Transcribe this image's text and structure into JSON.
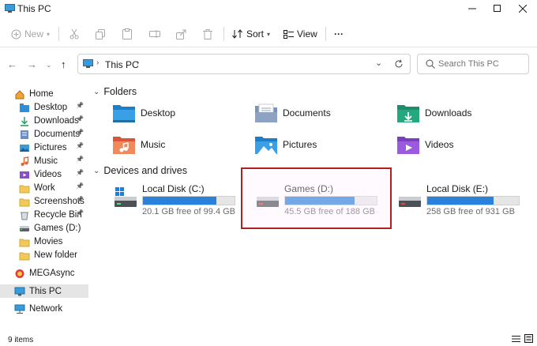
{
  "window": {
    "title": "This PC"
  },
  "toolbar": {
    "new_label": "New",
    "sort_label": "Sort",
    "view_label": "View",
    "more_label": "···"
  },
  "address": {
    "location": "This PC",
    "search_placeholder": "Search This PC"
  },
  "sidebar": {
    "items": [
      {
        "label": "Home",
        "icon": "home-icon"
      },
      {
        "label": "Desktop",
        "icon": "desktop-folder-icon",
        "pinned": true
      },
      {
        "label": "Downloads",
        "icon": "download-icon",
        "pinned": true
      },
      {
        "label": "Documents",
        "icon": "documents-icon",
        "pinned": true
      },
      {
        "label": "Pictures",
        "icon": "pictures-icon",
        "pinned": true
      },
      {
        "label": "Music",
        "icon": "music-icon",
        "pinned": true
      },
      {
        "label": "Videos",
        "icon": "videos-icon",
        "pinned": true
      },
      {
        "label": "Work",
        "icon": "folder-icon",
        "pinned": true
      },
      {
        "label": "Screenshots",
        "icon": "folder-icon",
        "pinned": true
      },
      {
        "label": "Recycle Bin",
        "icon": "recycle-bin-icon",
        "pinned": true
      },
      {
        "label": "Games (D:)",
        "icon": "drive-icon"
      },
      {
        "label": "Movies",
        "icon": "folder-icon"
      },
      {
        "label": "New folder",
        "icon": "folder-icon"
      },
      {
        "label": "MEGAsync",
        "icon": "megasync-icon"
      },
      {
        "label": "This PC",
        "icon": "this-pc-icon",
        "selected": true
      },
      {
        "label": "Network",
        "icon": "network-icon"
      }
    ]
  },
  "folders": {
    "heading": "Folders",
    "items": [
      {
        "label": "Desktop",
        "icon": "desktop-folder-icon"
      },
      {
        "label": "Documents",
        "icon": "documents-folder-icon"
      },
      {
        "label": "Downloads",
        "icon": "downloads-folder-icon"
      },
      {
        "label": "Music",
        "icon": "music-folder-icon"
      },
      {
        "label": "Pictures",
        "icon": "pictures-folder-icon"
      },
      {
        "label": "Videos",
        "icon": "videos-folder-icon"
      }
    ]
  },
  "drives": {
    "heading": "Devices and drives",
    "items": [
      {
        "name": "Local Disk (C:)",
        "free_text": "20.1 GB free of 99.4 GB",
        "used_fraction": 0.8,
        "icon": "windows-drive-icon"
      },
      {
        "name": "Games (D:)",
        "free_text": "45.5 GB free of 188 GB",
        "used_fraction": 0.76,
        "icon": "drive-icon",
        "highlighted": true
      },
      {
        "name": "Local Disk (E:)",
        "free_text": "258 GB free of 931 GB",
        "used_fraction": 0.72,
        "icon": "drive-icon"
      }
    ]
  },
  "status": {
    "items_count": "9 items"
  },
  "colors": {
    "accent": "#2a82da",
    "highlight_border": "#b02020",
    "selection": "#e5e5e5"
  }
}
